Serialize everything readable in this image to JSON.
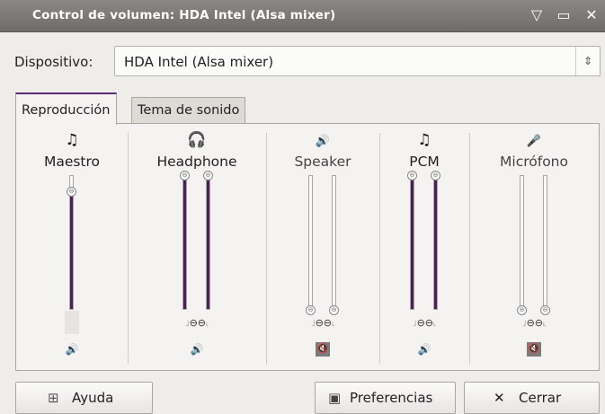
{
  "window": {
    "title": "Control de volumen: HDA Intel (Alsa mixer)",
    "controls": {
      "minimize": "▽",
      "maximize": "▭",
      "close": "✕"
    }
  },
  "device": {
    "label": "Dispositivo:",
    "value": "HDA Intel (Alsa mixer)",
    "arrow": "⇕"
  },
  "tabs": [
    {
      "label": "Reproducción",
      "selected": true
    },
    {
      "label": "Tema de sonido",
      "selected": false
    }
  ],
  "channels": [
    {
      "name": "Maestro",
      "icon": "music-note-icon",
      "icon_glyph": "♫",
      "level": 0.88,
      "dual": false,
      "muted": false
    },
    {
      "name": "Headphone",
      "icon": "headphones-icon",
      "icon_glyph": "🎧",
      "levels": [
        1.0,
        1.0
      ],
      "dual": true,
      "muted": false
    },
    {
      "name": "Speaker",
      "icon": "speaker-icon",
      "icon_glyph": "🔊",
      "levels": [
        0.0,
        0.0
      ],
      "dual": true,
      "muted": true
    },
    {
      "name": "PCM",
      "icon": "music-note-icon",
      "icon_glyph": "♫",
      "levels": [
        1.0,
        1.0
      ],
      "dual": true,
      "muted": false
    },
    {
      "name": "Micrófono",
      "icon": "microphone-icon",
      "icon_glyph": "🎤",
      "levels": [
        0.0,
        0.0
      ],
      "dual": true,
      "muted": true
    }
  ],
  "buttons": {
    "help": "Ayuda",
    "preferences": "Preferencias",
    "close": "Cerrar"
  },
  "colors": {
    "accent": "#4a2159",
    "titlebar": "#7b7875",
    "background": "#efedea"
  }
}
